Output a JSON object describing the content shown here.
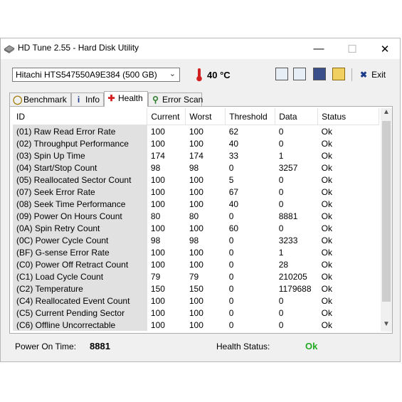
{
  "window": {
    "title": "HD Tune 2.55 - Hard Disk Utility"
  },
  "titlebar_buttons": {
    "minimize": "—",
    "maximize": "☐",
    "close": "✕"
  },
  "toolbar": {
    "drive": "Hitachi HTS547550A9E384 (500 GB)",
    "temperature": "40 °C",
    "exit_label": "Exit"
  },
  "tabs": [
    {
      "label": "Benchmark",
      "icon": "bulb-icon"
    },
    {
      "label": "Info",
      "icon": "info-icon"
    },
    {
      "label": "Health",
      "icon": "health-cross-icon",
      "active": true
    },
    {
      "label": "Error Scan",
      "icon": "magnifier-icon"
    }
  ],
  "table": {
    "headers": [
      "ID",
      "Current",
      "Worst",
      "Threshold",
      "Data",
      "Status"
    ],
    "rows": [
      [
        "(01) Raw Read Error Rate",
        "100",
        "100",
        "62",
        "0",
        "Ok"
      ],
      [
        "(02) Throughput Performance",
        "100",
        "100",
        "40",
        "0",
        "Ok"
      ],
      [
        "(03) Spin Up Time",
        "174",
        "174",
        "33",
        "1",
        "Ok"
      ],
      [
        "(04) Start/Stop Count",
        "98",
        "98",
        "0",
        "3257",
        "Ok"
      ],
      [
        "(05) Reallocated Sector Count",
        "100",
        "100",
        "5",
        "0",
        "Ok"
      ],
      [
        "(07) Seek Error Rate",
        "100",
        "100",
        "67",
        "0",
        "Ok"
      ],
      [
        "(08) Seek Time Performance",
        "100",
        "100",
        "40",
        "0",
        "Ok"
      ],
      [
        "(09) Power On Hours Count",
        "80",
        "80",
        "0",
        "8881",
        "Ok"
      ],
      [
        "(0A) Spin Retry Count",
        "100",
        "100",
        "60",
        "0",
        "Ok"
      ],
      [
        "(0C) Power Cycle Count",
        "98",
        "98",
        "0",
        "3233",
        "Ok"
      ],
      [
        "(BF) G-sense Error Rate",
        "100",
        "100",
        "0",
        "1",
        "Ok"
      ],
      [
        "(C0) Power Off Retract Count",
        "100",
        "100",
        "0",
        "28",
        "Ok"
      ],
      [
        "(C1) Load Cycle Count",
        "79",
        "79",
        "0",
        "210205",
        "Ok"
      ],
      [
        "(C2) Temperature",
        "150",
        "150",
        "0",
        "1179688",
        "Ok"
      ],
      [
        "(C4) Reallocated Event Count",
        "100",
        "100",
        "0",
        "0",
        "Ok"
      ],
      [
        "(C5) Current Pending Sector",
        "100",
        "100",
        "0",
        "0",
        "Ok"
      ],
      [
        "(C6) Offline Uncorrectable",
        "100",
        "100",
        "0",
        "0",
        "Ok"
      ]
    ]
  },
  "status_bar": {
    "power_on_label": "Power On Time:",
    "power_on_value": "8881",
    "health_label": "Health Status:",
    "health_value": "Ok",
    "health_color": "#22aa22"
  }
}
